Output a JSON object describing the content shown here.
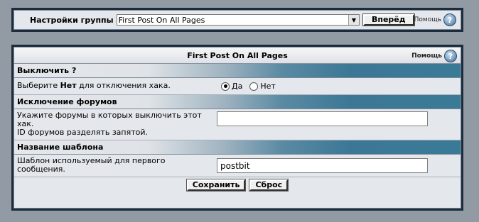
{
  "topbar": {
    "group_label": "Настройки группы",
    "selected_group": "First Post On All Pages",
    "go_button": "Вперёд",
    "help_label": "Помощь",
    "help_icon": "?"
  },
  "settings": {
    "title": "First Post On All Pages",
    "help_label": "Помощь",
    "help_icon": "?",
    "sections": [
      {
        "heading": "Выключить ?",
        "description_pre": "Выберите ",
        "description_bold": "Нет",
        "description_post": " для отключения хака.",
        "options": [
          "Да",
          "Нет"
        ],
        "selected": "Да"
      },
      {
        "heading": "Исключение форумов",
        "description_line1": "Укажите форумы в которых выключить этот хак.",
        "description_line2": "ID форумов разделять запятой.",
        "value": ""
      },
      {
        "heading": "Название шаблона",
        "description": "Шаблон используемый для первого сообщения.",
        "value": "postbit"
      }
    ],
    "save_button": "Сохранить",
    "reset_button": "Сброс"
  },
  "colors": {
    "page_bg": "#929aa4",
    "panel_border": "#1b2c3d",
    "section_gradient_end": "#3a7a96"
  }
}
